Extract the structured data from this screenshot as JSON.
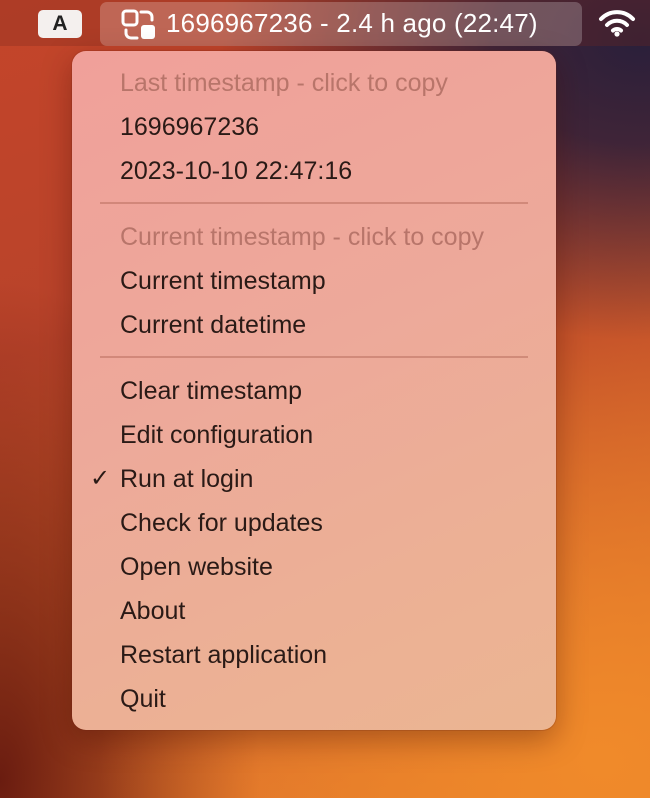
{
  "menubar": {
    "input_source_label": "A",
    "status_text": "1696967236 - 2.4 h ago (22:47)",
    "status_icon": "timestamp-convert-icon",
    "wifi_icon": "wifi-icon"
  },
  "menu": {
    "last_header": "Last timestamp - click to copy",
    "last_unix": "1696967236",
    "last_datetime": "2023-10-10 22:47:16",
    "current_header": "Current timestamp - click to copy",
    "current_timestamp": "Current timestamp",
    "current_datetime": "Current datetime",
    "clear_timestamp": "Clear timestamp",
    "edit_configuration": "Edit configuration",
    "run_at_login": "Run at login",
    "run_at_login_checked": true,
    "check_mark": "✓",
    "check_for_updates": "Check for updates",
    "open_website": "Open website",
    "about": "About",
    "restart_application": "Restart application",
    "quit": "Quit"
  }
}
